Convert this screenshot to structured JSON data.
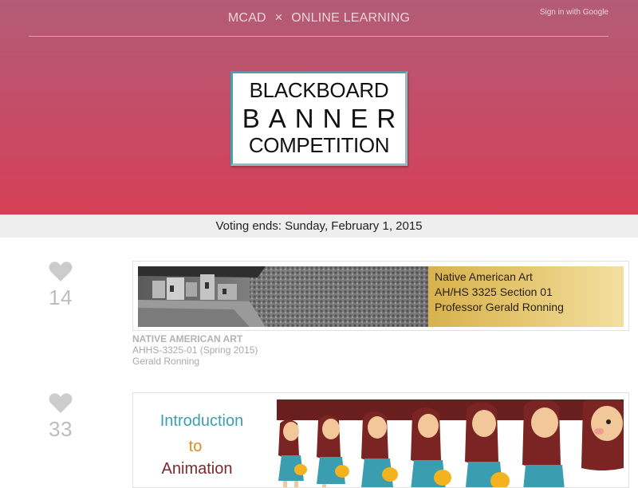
{
  "header": {
    "brand_left": "MCAD",
    "brand_separator": "×",
    "brand_right": "ONLINE LEARNING",
    "signin_label": "Sign in with Google"
  },
  "logo": {
    "line1": "BLACKBOARD",
    "line2": "BANNER",
    "line3": "COMPETITION"
  },
  "voting": {
    "text": "Voting ends: Sunday, February 1, 2015"
  },
  "entries": [
    {
      "votes": "14",
      "course_title": "NATIVE AMERICAN ART",
      "course_code": "AHHS-3325-01 (Spring 2015)",
      "instructor": "Gerald Ronning",
      "banner_lines": [
        "Native American Art",
        "AH/HS 3325 Section 01",
        "Professor Gerald Ronning"
      ]
    },
    {
      "votes": "33",
      "banner_lines": [
        "Introduction",
        "to",
        "Animation"
      ]
    }
  ],
  "icons": {
    "vote": "heart-icon",
    "separator": "close-x-icon"
  },
  "colors": {
    "hero_top": "#b35d76",
    "hero_bottom": "#d63f55",
    "logo_border": "#3aa6ad",
    "heart": "#cccccc",
    "count": "#bdbdbd",
    "banner1_gold": "#e3c36a",
    "banner2_teal": "#3aa0ad",
    "banner2_orange": "#e08a1e",
    "banner2_maroon": "#7a2a2a"
  }
}
